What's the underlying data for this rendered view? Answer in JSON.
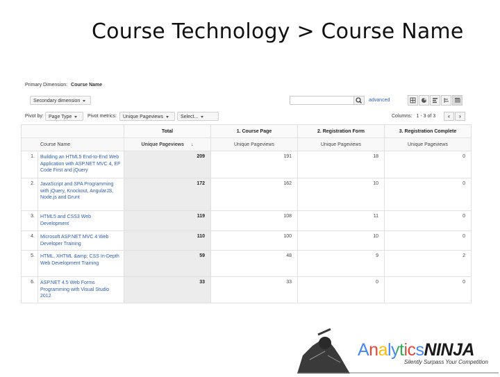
{
  "slide": {
    "title": "Course Technology > Course Name"
  },
  "toolbar": {
    "primary_dimension_label": "Primary Dimension:",
    "primary_dimension_value": "Course Name",
    "secondary_dimension": "Secondary dimension",
    "advanced": "advanced",
    "pivot_by_label": "Pivot by:",
    "pivot_by_value": "Page Type",
    "pivot_metrics_label": "Pivot metrics:",
    "pivot_metric_1": "Unique Pageviews",
    "pivot_metric_2": "Select...",
    "columns_label": "Columns:",
    "columns_range": "1 - 3 of 3"
  },
  "table": {
    "group_headers": [
      "Total",
      "1. Course Page",
      "2. Registration Form",
      "3. Registration Complete"
    ],
    "dimension_header": "Course Name",
    "metric_header": "Unique Pageviews",
    "rows": [
      {
        "index": "1.",
        "name": "Building an HTML5 End-to-End Web Application with ASP.NET MVC 4, EF Code First and jQuery",
        "total": "209",
        "course_page": "191",
        "registration_form": "18",
        "registration_complete": "0"
      },
      {
        "index": "2.",
        "name": "JavaScript and SPA Programming with jQuery, Knockout, AngularJS, Node.js and Grunt",
        "total": "172",
        "course_page": "162",
        "registration_form": "10",
        "registration_complete": "0"
      },
      {
        "index": "3.",
        "name": "HTML5 and CSS3 Web Development",
        "total": "119",
        "course_page": "108",
        "registration_form": "11",
        "registration_complete": "0"
      },
      {
        "index": "4.",
        "name": "Microsoft ASP.NET MVC 4 Web Developer Training",
        "total": "110",
        "course_page": "100",
        "registration_form": "10",
        "registration_complete": "0"
      },
      {
        "index": "5.",
        "name": "HTML, XHTML &amp; CSS In-Depth Web Development Training",
        "total": "59",
        "course_page": "48",
        "registration_form": "9",
        "registration_complete": "2"
      },
      {
        "index": "6.",
        "name": "ASP.NET 4.5 Web Forms Programming with Visual Studio 2012",
        "total": "33",
        "course_page": "33",
        "registration_form": "0",
        "registration_complete": "0"
      }
    ]
  },
  "logo": {
    "analytics": "Analytics",
    "ninja": "NINJA",
    "tagline": "Silently Surpass Your Competition"
  },
  "colors": {
    "link": "#2a5db0",
    "logo_ninja": "#1a1a1a"
  },
  "icons": [
    "search-icon",
    "table-view-icon",
    "pie-view-icon",
    "bar-view-icon",
    "comparison-view-icon",
    "pivot-view-icon",
    "chevron-left-icon",
    "chevron-right-icon",
    "sort-arrow-icon",
    "ninja-figure-icon"
  ]
}
